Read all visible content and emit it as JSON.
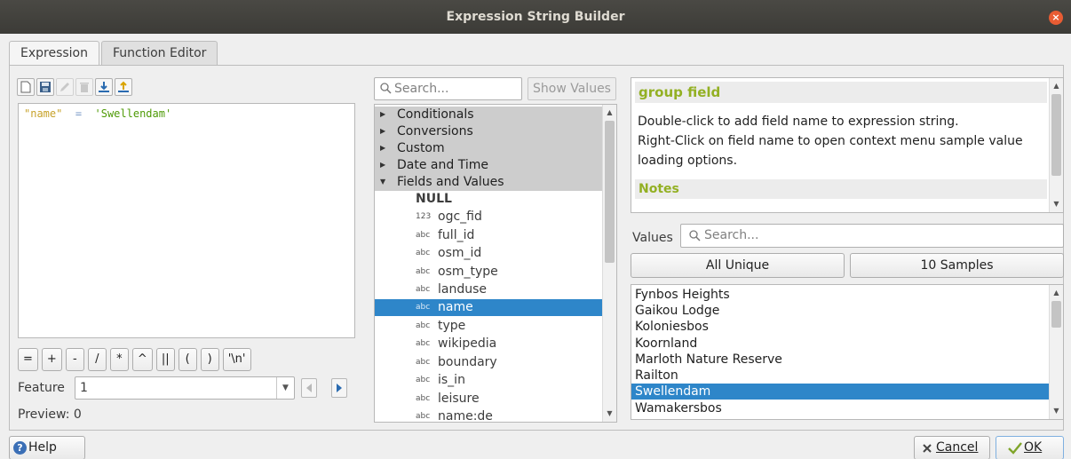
{
  "window": {
    "title": "Expression String Builder",
    "close_glyph": "×"
  },
  "tabs": [
    {
      "label": "Expression",
      "active": true
    },
    {
      "label": "Function Editor",
      "active": false
    }
  ],
  "toolbar": {
    "icons": [
      "new-file-icon",
      "save-icon",
      "edit-icon",
      "delete-icon",
      "import-icon",
      "export-icon"
    ]
  },
  "editor": {
    "field": "\"name\"",
    "operator": "=",
    "value": "'Swellendam'"
  },
  "operators": [
    "=",
    "+",
    "-",
    "/",
    "*",
    "^",
    "||",
    "(",
    ")",
    "'\\n'"
  ],
  "feature": {
    "label": "Feature",
    "value": "1"
  },
  "preview": {
    "label": "Preview:",
    "value": "0"
  },
  "function_search": {
    "placeholder": "Search..."
  },
  "show_values_label": "Show Values",
  "tree": {
    "groups": [
      "Conditionals",
      "Conversions",
      "Custom",
      "Date and Time",
      "Fields and Values"
    ],
    "fields": [
      {
        "type": "",
        "label": "NULL",
        "bold": true
      },
      {
        "type": "123",
        "label": "ogc_fid"
      },
      {
        "type": "abc",
        "label": "full_id"
      },
      {
        "type": "abc",
        "label": "osm_id"
      },
      {
        "type": "abc",
        "label": "osm_type"
      },
      {
        "type": "abc",
        "label": "landuse"
      },
      {
        "type": "abc",
        "label": "name",
        "selected": true
      },
      {
        "type": "abc",
        "label": "type"
      },
      {
        "type": "abc",
        "label": "wikipedia"
      },
      {
        "type": "abc",
        "label": "boundary"
      },
      {
        "type": "abc",
        "label": "is_in"
      },
      {
        "type": "abc",
        "label": "leisure"
      },
      {
        "type": "abc",
        "label": "name:de"
      }
    ]
  },
  "help": {
    "title": "group field",
    "line1": "Double-click to add field name to expression string.",
    "line2": "Right-Click on field name to open context menu sample value",
    "line3": "loading options.",
    "notes": "Notes"
  },
  "values": {
    "label": "Values",
    "search_placeholder": "Search...",
    "all_unique_label": "All Unique",
    "samples_label": "10 Samples",
    "items": [
      "Fynbos Heights",
      "Gaikou Lodge",
      "Koloniesbos",
      "Koornland",
      "Marloth Nature Reserve",
      "Railton",
      "Swellendam",
      "Wamakersbos"
    ],
    "selected": "Swellendam"
  },
  "footer": {
    "help_label": "Help",
    "help_glyph": "?",
    "cancel_label": "Cancel",
    "ok_label": "OK"
  },
  "colors": {
    "selection": "#2e86c9",
    "help_heading": "#93b023",
    "field_token": "#c7a22a",
    "string_token": "#4e9a06",
    "close_button": "#e85c33"
  }
}
